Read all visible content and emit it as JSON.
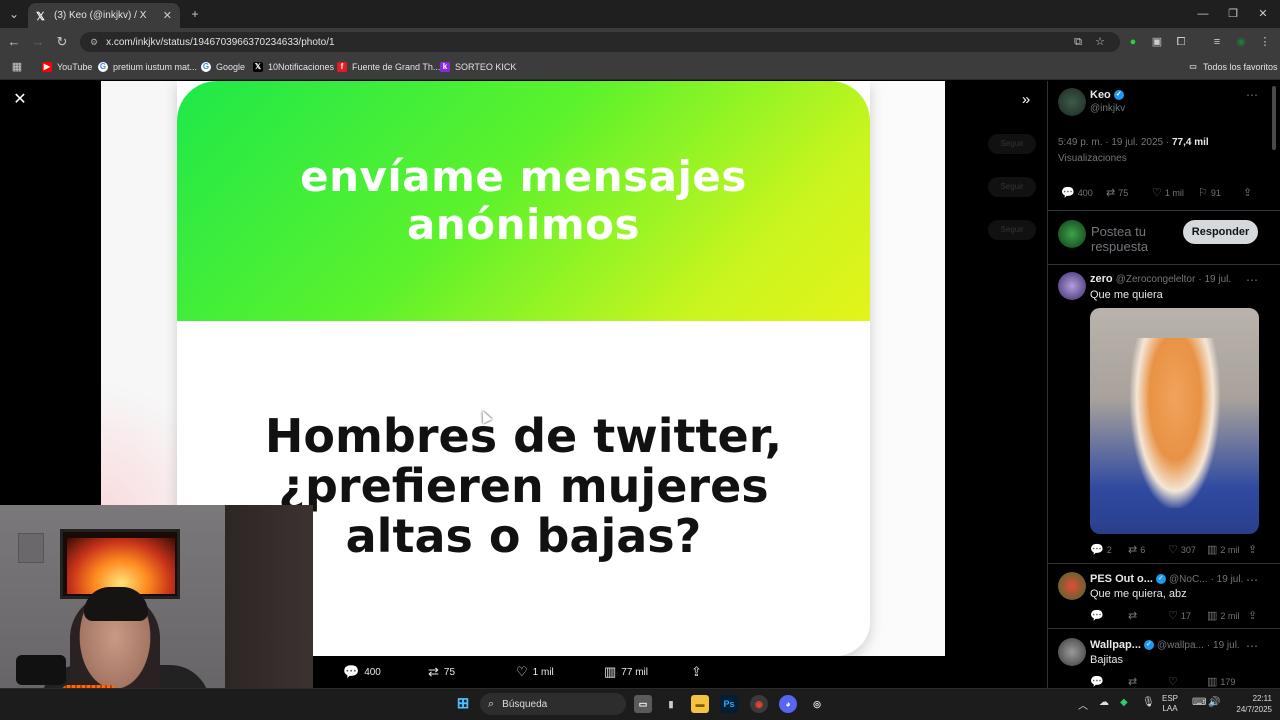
{
  "browser": {
    "tab_title": "(3) Keo (@inkjkv) / X",
    "url": "x.com/inkjkv/status/1946703966370234633/photo/1",
    "new_tab_label": "+",
    "bookmarks": [
      {
        "label": "YouTube",
        "color": "#ff0000"
      },
      {
        "label": "pretium iustum mat...",
        "color": "#ffffff"
      },
      {
        "label": "Google",
        "color": "#ffffff"
      },
      {
        "label": "10Notificaciones",
        "color": "#000000"
      },
      {
        "label": "Fuente de Grand Th...",
        "color": "#e31b23"
      },
      {
        "label": "SORTEO KICK",
        "color": "#8a2be2"
      }
    ],
    "all_bookmarks_label": "Todos los favoritos"
  },
  "image": {
    "heading_line1": "envíame mensajes",
    "heading_line2": "anónimos",
    "question_line1": "Hombres de twitter,",
    "question_line2": "¿prefieren mujeres",
    "question_line3": "altas o bajas?",
    "gradient_start": "#1ee84a",
    "gradient_end": "#e4f41a"
  },
  "photo_actions": {
    "replies": "400",
    "reposts": "75",
    "likes": "1 mil",
    "views": "77 mil"
  },
  "sidebar": {
    "author_name": "Keo",
    "author_handle": "@inkjkv",
    "timestamp": "5:49 p. m. · 19 jul. 2025 · ",
    "views_count": "77,4 mil",
    "views_label": "Visualizaciones",
    "stats": {
      "replies": "400",
      "reposts": "75",
      "likes": "1 mil",
      "bookmarks": "91"
    },
    "reply_placeholder": "Postea tu respuesta",
    "reply_button": "Responder",
    "ghost_buttons": [
      "Seguir",
      "Seguir",
      "Seguir"
    ],
    "replies": [
      {
        "name": "zero",
        "handle": "@Zerocongeleltor",
        "date": "· 19 jul.",
        "text": "Que me quiera",
        "stats": {
          "replies": "2",
          "reposts": "6",
          "likes": "307",
          "views": "2 mil"
        }
      },
      {
        "name": "PES Out o...",
        "handle": "@NoC...",
        "date": "· 19 jul.",
        "text": "Que me quiera, abz",
        "stats": {
          "replies": "",
          "reposts": "",
          "likes": "17",
          "views": "2 mil"
        }
      },
      {
        "name": "Wallpap...",
        "handle": "@wallpa...",
        "date": "· 19 jul.",
        "text": "Bajitas",
        "stats": {
          "replies": "",
          "reposts": "",
          "likes": "",
          "views": "179"
        }
      }
    ]
  },
  "taskbar": {
    "search_placeholder": "Búsqueda",
    "lang_line1": "ESP",
    "lang_line2": "LAA",
    "time": "22:11",
    "date": "24/7/2025"
  }
}
